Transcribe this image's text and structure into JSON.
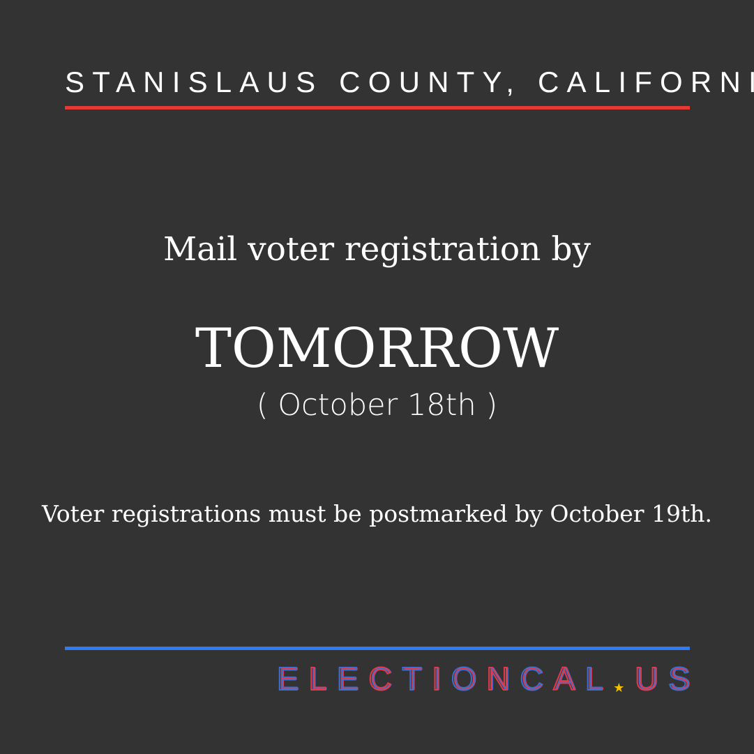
{
  "header": {
    "county_label": "STANISLAUS COUNTY, CALIFORNIA"
  },
  "main": {
    "lead_text": "Mail voter registration by",
    "headline": "TOMORROW",
    "date_text": "( October 18th )",
    "note_text": "Voter registrations must be postmarked by October 19th."
  },
  "brand": {
    "wordmark": "ELECTIONCAL.US",
    "letters": [
      "E",
      "L",
      "E",
      "C",
      "T",
      "I",
      "O",
      "N",
      "C",
      "A",
      "L",
      "★",
      "U",
      "S"
    ],
    "star_icon": "star-icon"
  },
  "colors": {
    "background": "#333333",
    "text": "#ffffff",
    "accent_red": "#e53935",
    "accent_blue": "#2f7bf5",
    "star_yellow": "#f2c200",
    "brand_red": "#e5394a",
    "brand_blue": "#3d6fd1"
  }
}
